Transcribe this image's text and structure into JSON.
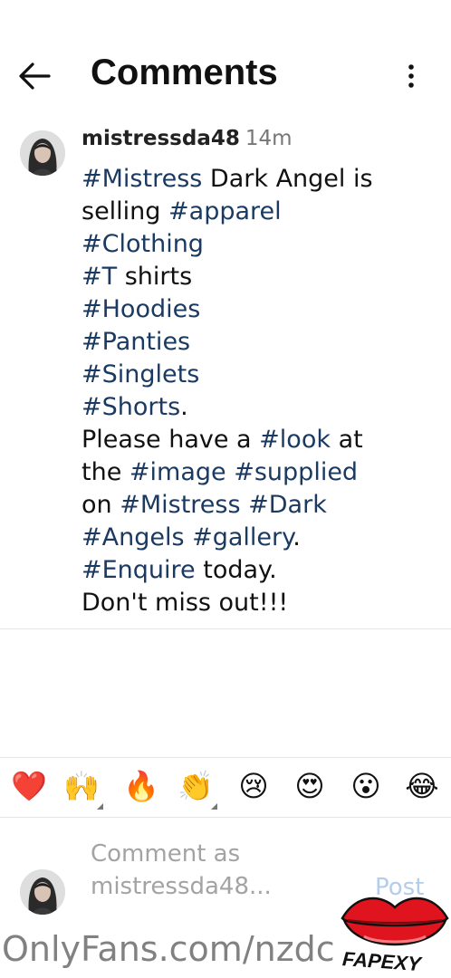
{
  "header": {
    "title": "Comments",
    "back_icon": "arrow-left-icon",
    "more_icon": "more-vertical-icon"
  },
  "comment": {
    "username": "mistressda48",
    "time": "14m",
    "lines": [
      [
        {
          "t": "#Mistress",
          "tag": true
        },
        {
          "t": " Dark Angel is",
          "tag": false
        }
      ],
      [
        {
          "t": "selling ",
          "tag": false
        },
        {
          "t": "#apparel",
          "tag": true
        }
      ],
      [
        {
          "t": "#Clothing",
          "tag": true
        }
      ],
      [
        {
          "t": "#T",
          "tag": true
        },
        {
          "t": " shirts",
          "tag": false
        }
      ],
      [
        {
          "t": "#Hoodies",
          "tag": true
        }
      ],
      [
        {
          "t": "#Panties",
          "tag": true
        }
      ],
      [
        {
          "t": "#Singlets",
          "tag": true
        }
      ],
      [
        {
          "t": "#Shorts",
          "tag": true
        },
        {
          "t": ".",
          "tag": false
        }
      ],
      [
        {
          "t": "Please have a ",
          "tag": false
        },
        {
          "t": "#look",
          "tag": true
        },
        {
          "t": " at",
          "tag": false
        }
      ],
      [
        {
          "t": "the ",
          "tag": false
        },
        {
          "t": "#image",
          "tag": true
        },
        {
          "t": " ",
          "tag": false
        },
        {
          "t": "#supplied",
          "tag": true
        }
      ],
      [
        {
          "t": "on ",
          "tag": false
        },
        {
          "t": "#Mistress",
          "tag": true
        },
        {
          "t": " ",
          "tag": false
        },
        {
          "t": "#Dark",
          "tag": true
        }
      ],
      [
        {
          "t": "#Angels",
          "tag": true
        },
        {
          "t": " ",
          "tag": false
        },
        {
          "t": "#gallery",
          "tag": true
        },
        {
          "t": ".",
          "tag": false
        }
      ],
      [
        {
          "t": "#Enquire",
          "tag": true
        },
        {
          "t": " today.",
          "tag": false
        }
      ],
      [
        {
          "t": "Don't miss out!!!",
          "tag": false
        }
      ]
    ]
  },
  "reactions": [
    {
      "emoji": "❤️",
      "name": "red-heart",
      "more": false
    },
    {
      "emoji": "🙌",
      "name": "raising-hands",
      "more": true
    },
    {
      "emoji": "🔥",
      "name": "fire",
      "more": false
    },
    {
      "emoji": "👏",
      "name": "clapping-hands",
      "more": true
    },
    {
      "emoji": "😢",
      "name": "crying-face",
      "more": false
    },
    {
      "emoji": "😍",
      "name": "heart-eyes",
      "more": false
    },
    {
      "emoji": "😮",
      "name": "open-mouth-face",
      "more": false
    },
    {
      "emoji": "😂",
      "name": "tears-of-joy",
      "more": false
    }
  ],
  "composer": {
    "placeholder_line1": "Comment as",
    "placeholder_line2": "mistressda48...",
    "post_label": "Post",
    "post_color": "#b3cdea"
  },
  "watermark": {
    "text": "OnlyFans.com/nzdc",
    "logo_text": "FAPEXY",
    "logo_color": "#e0141e"
  },
  "colors": {
    "hashtag": "#1b3a61",
    "text": "#111111",
    "muted": "#777777"
  }
}
